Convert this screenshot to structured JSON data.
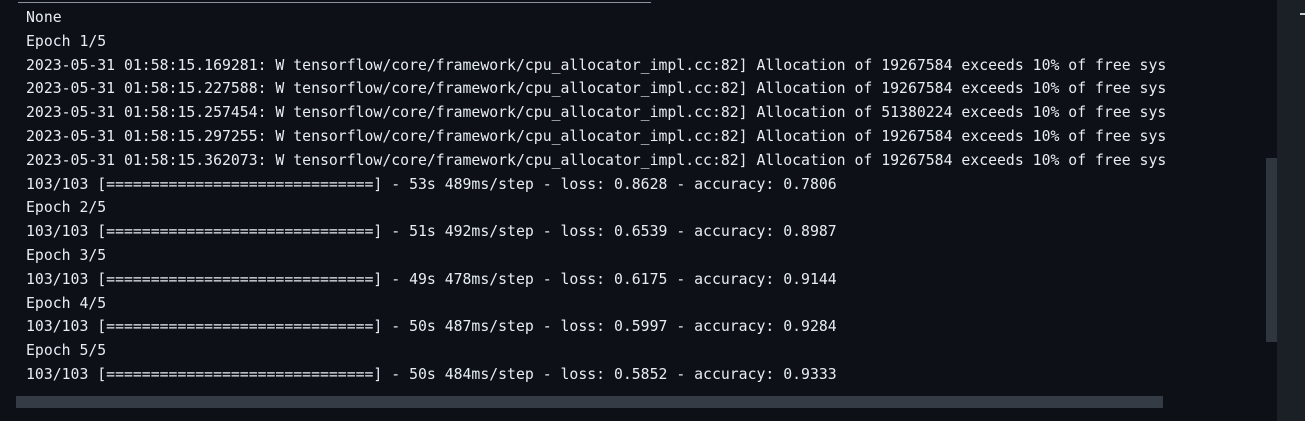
{
  "output": {
    "lines": [
      "None",
      "Epoch 1/5",
      "2023-05-31 01:58:15.169281: W tensorflow/core/framework/cpu_allocator_impl.cc:82] Allocation of 19267584 exceeds 10% of free sys",
      "2023-05-31 01:58:15.227588: W tensorflow/core/framework/cpu_allocator_impl.cc:82] Allocation of 19267584 exceeds 10% of free sys",
      "2023-05-31 01:58:15.257454: W tensorflow/core/framework/cpu_allocator_impl.cc:82] Allocation of 51380224 exceeds 10% of free sys",
      "2023-05-31 01:58:15.297255: W tensorflow/core/framework/cpu_allocator_impl.cc:82] Allocation of 19267584 exceeds 10% of free sys",
      "2023-05-31 01:58:15.362073: W tensorflow/core/framework/cpu_allocator_impl.cc:82] Allocation of 19267584 exceeds 10% of free sys",
      "103/103 [==============================] - 53s 489ms/step - loss: 0.8628 - accuracy: 0.7806",
      "Epoch 2/5",
      "103/103 [==============================] - 51s 492ms/step - loss: 0.6539 - accuracy: 0.8987",
      "Epoch 3/5",
      "103/103 [==============================] - 49s 478ms/step - loss: 0.6175 - accuracy: 0.9144",
      "Epoch 4/5",
      "103/103 [==============================] - 50s 487ms/step - loss: 0.5997 - accuracy: 0.9284",
      "Epoch 5/5",
      "103/103 [==============================] - 50s 484ms/step - loss: 0.5852 - accuracy: 0.9333"
    ]
  },
  "colors": {
    "background": "#0d1117",
    "text": "#e6edf3",
    "scrollbar": "#353b44",
    "gutter": "#1b1f26"
  }
}
